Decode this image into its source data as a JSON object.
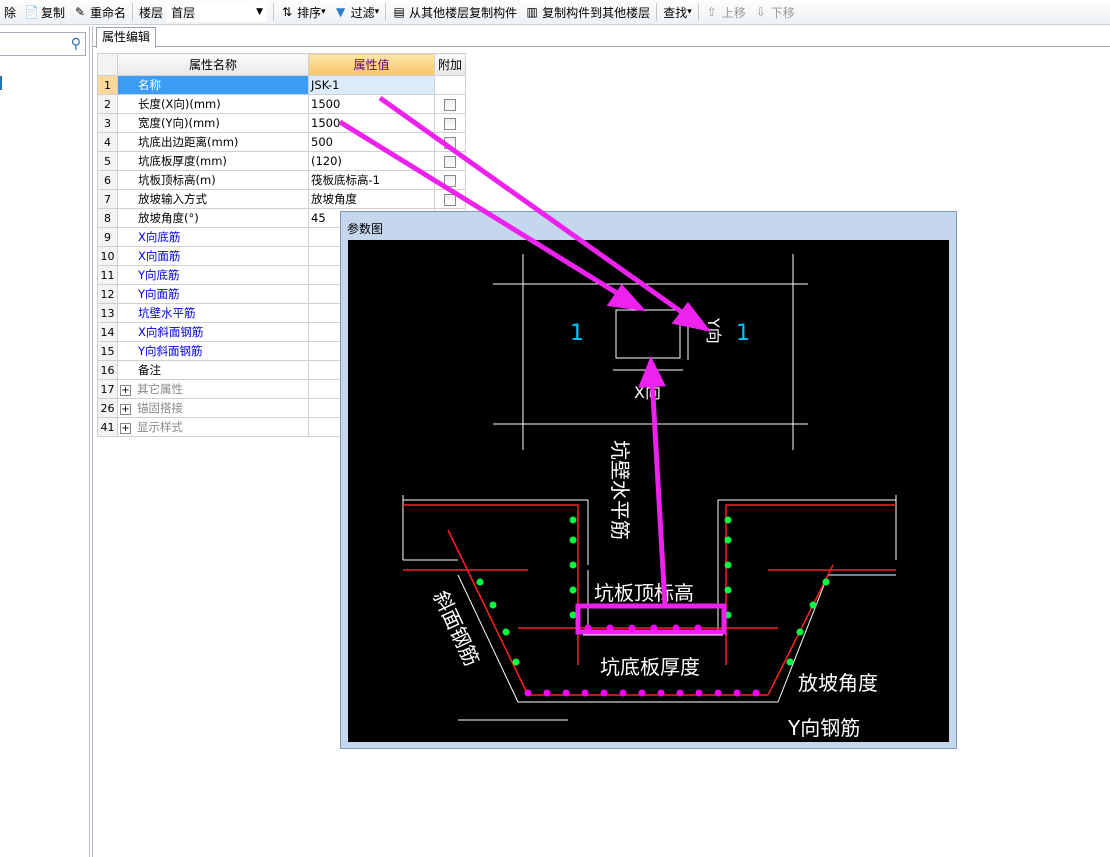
{
  "toolbar": {
    "items": [
      {
        "label": "除",
        "icon": "delete-icon"
      },
      {
        "label": "复制",
        "icon": "copy-icon"
      },
      {
        "label": "重命名",
        "icon": "rename-icon"
      },
      {
        "label": "楼层"
      },
      {
        "label": "排序",
        "icon": "sort-az-icon"
      },
      {
        "label": "过滤",
        "icon": "filter-icon"
      },
      {
        "label": "从其他楼层复制构件",
        "icon": "copy-from-floor-icon"
      },
      {
        "label": "复制构件到其他楼层",
        "icon": "copy-to-floor-icon"
      },
      {
        "label": "查找"
      },
      {
        "label": "上移",
        "icon": "arrow-up-icon"
      },
      {
        "label": "下移",
        "icon": "arrow-down-icon"
      }
    ],
    "floor_value": "首层"
  },
  "search": {
    "placeholder": ""
  },
  "tab": {
    "label": "属性编辑"
  },
  "table": {
    "headers": [
      "属性名称",
      "属性值",
      "附加"
    ],
    "rows": [
      {
        "n": "1",
        "name": "名称",
        "value": "JSK-1",
        "style": "sel",
        "check": false
      },
      {
        "n": "2",
        "name": "长度(X向)(mm)",
        "value": "1500",
        "check": true
      },
      {
        "n": "3",
        "name": "宽度(Y向)(mm)",
        "value": "1500",
        "check": true
      },
      {
        "n": "4",
        "name": "坑底出边距离(mm)",
        "value": "500",
        "check": true
      },
      {
        "n": "5",
        "name": "坑底板厚度(mm)",
        "value": "(120)",
        "check": true
      },
      {
        "n": "6",
        "name": "坑板顶标高(m)",
        "value": "筏板底标高-1",
        "check": true
      },
      {
        "n": "7",
        "name": "放坡输入方式",
        "value": "放坡角度",
        "check": true
      },
      {
        "n": "8",
        "name": "放坡角度(°)",
        "value": "45",
        "check": false
      },
      {
        "n": "9",
        "name": "X向底筋",
        "value": "",
        "style": "blue"
      },
      {
        "n": "10",
        "name": "X向面筋",
        "value": "",
        "style": "blue"
      },
      {
        "n": "11",
        "name": "Y向底筋",
        "value": "",
        "style": "blue"
      },
      {
        "n": "12",
        "name": "Y向面筋",
        "value": "",
        "style": "blue"
      },
      {
        "n": "13",
        "name": "坑壁水平筋",
        "value": "",
        "style": "blue"
      },
      {
        "n": "14",
        "name": "X向斜面钢筋",
        "value": "",
        "style": "blue"
      },
      {
        "n": "15",
        "name": "Y向斜面钢筋",
        "value": "",
        "style": "blue"
      },
      {
        "n": "16",
        "name": "备注",
        "value": ""
      },
      {
        "n": "17",
        "name": "其它属性",
        "value": "",
        "style": "group"
      },
      {
        "n": "26",
        "name": "锚固搭接",
        "value": "",
        "style": "group"
      },
      {
        "n": "41",
        "name": "显示样式",
        "value": "",
        "style": "group"
      }
    ]
  },
  "dialog": {
    "title": "参数图",
    "labels": {
      "sec1_left": "1",
      "sec1_right": "1",
      "y_dir": "Y向",
      "x_dir": "X向",
      "wall_rebar": "坑壁水平筋",
      "top_elev": "坑板顶标高",
      "slope_rebar": "斜面钢筋",
      "bottom_thick": "坑底板厚度",
      "slope_angle": "放坡角度",
      "y_rebar": "Y向钢筋"
    }
  },
  "colors": {
    "annotation": "#ee22ee",
    "rebar_red": "#ff2020",
    "dot_green": "#00ff40",
    "dot_magenta": "#ff00ff",
    "label_cyan": "#00c8ff",
    "selection": "#3b9cf5"
  }
}
